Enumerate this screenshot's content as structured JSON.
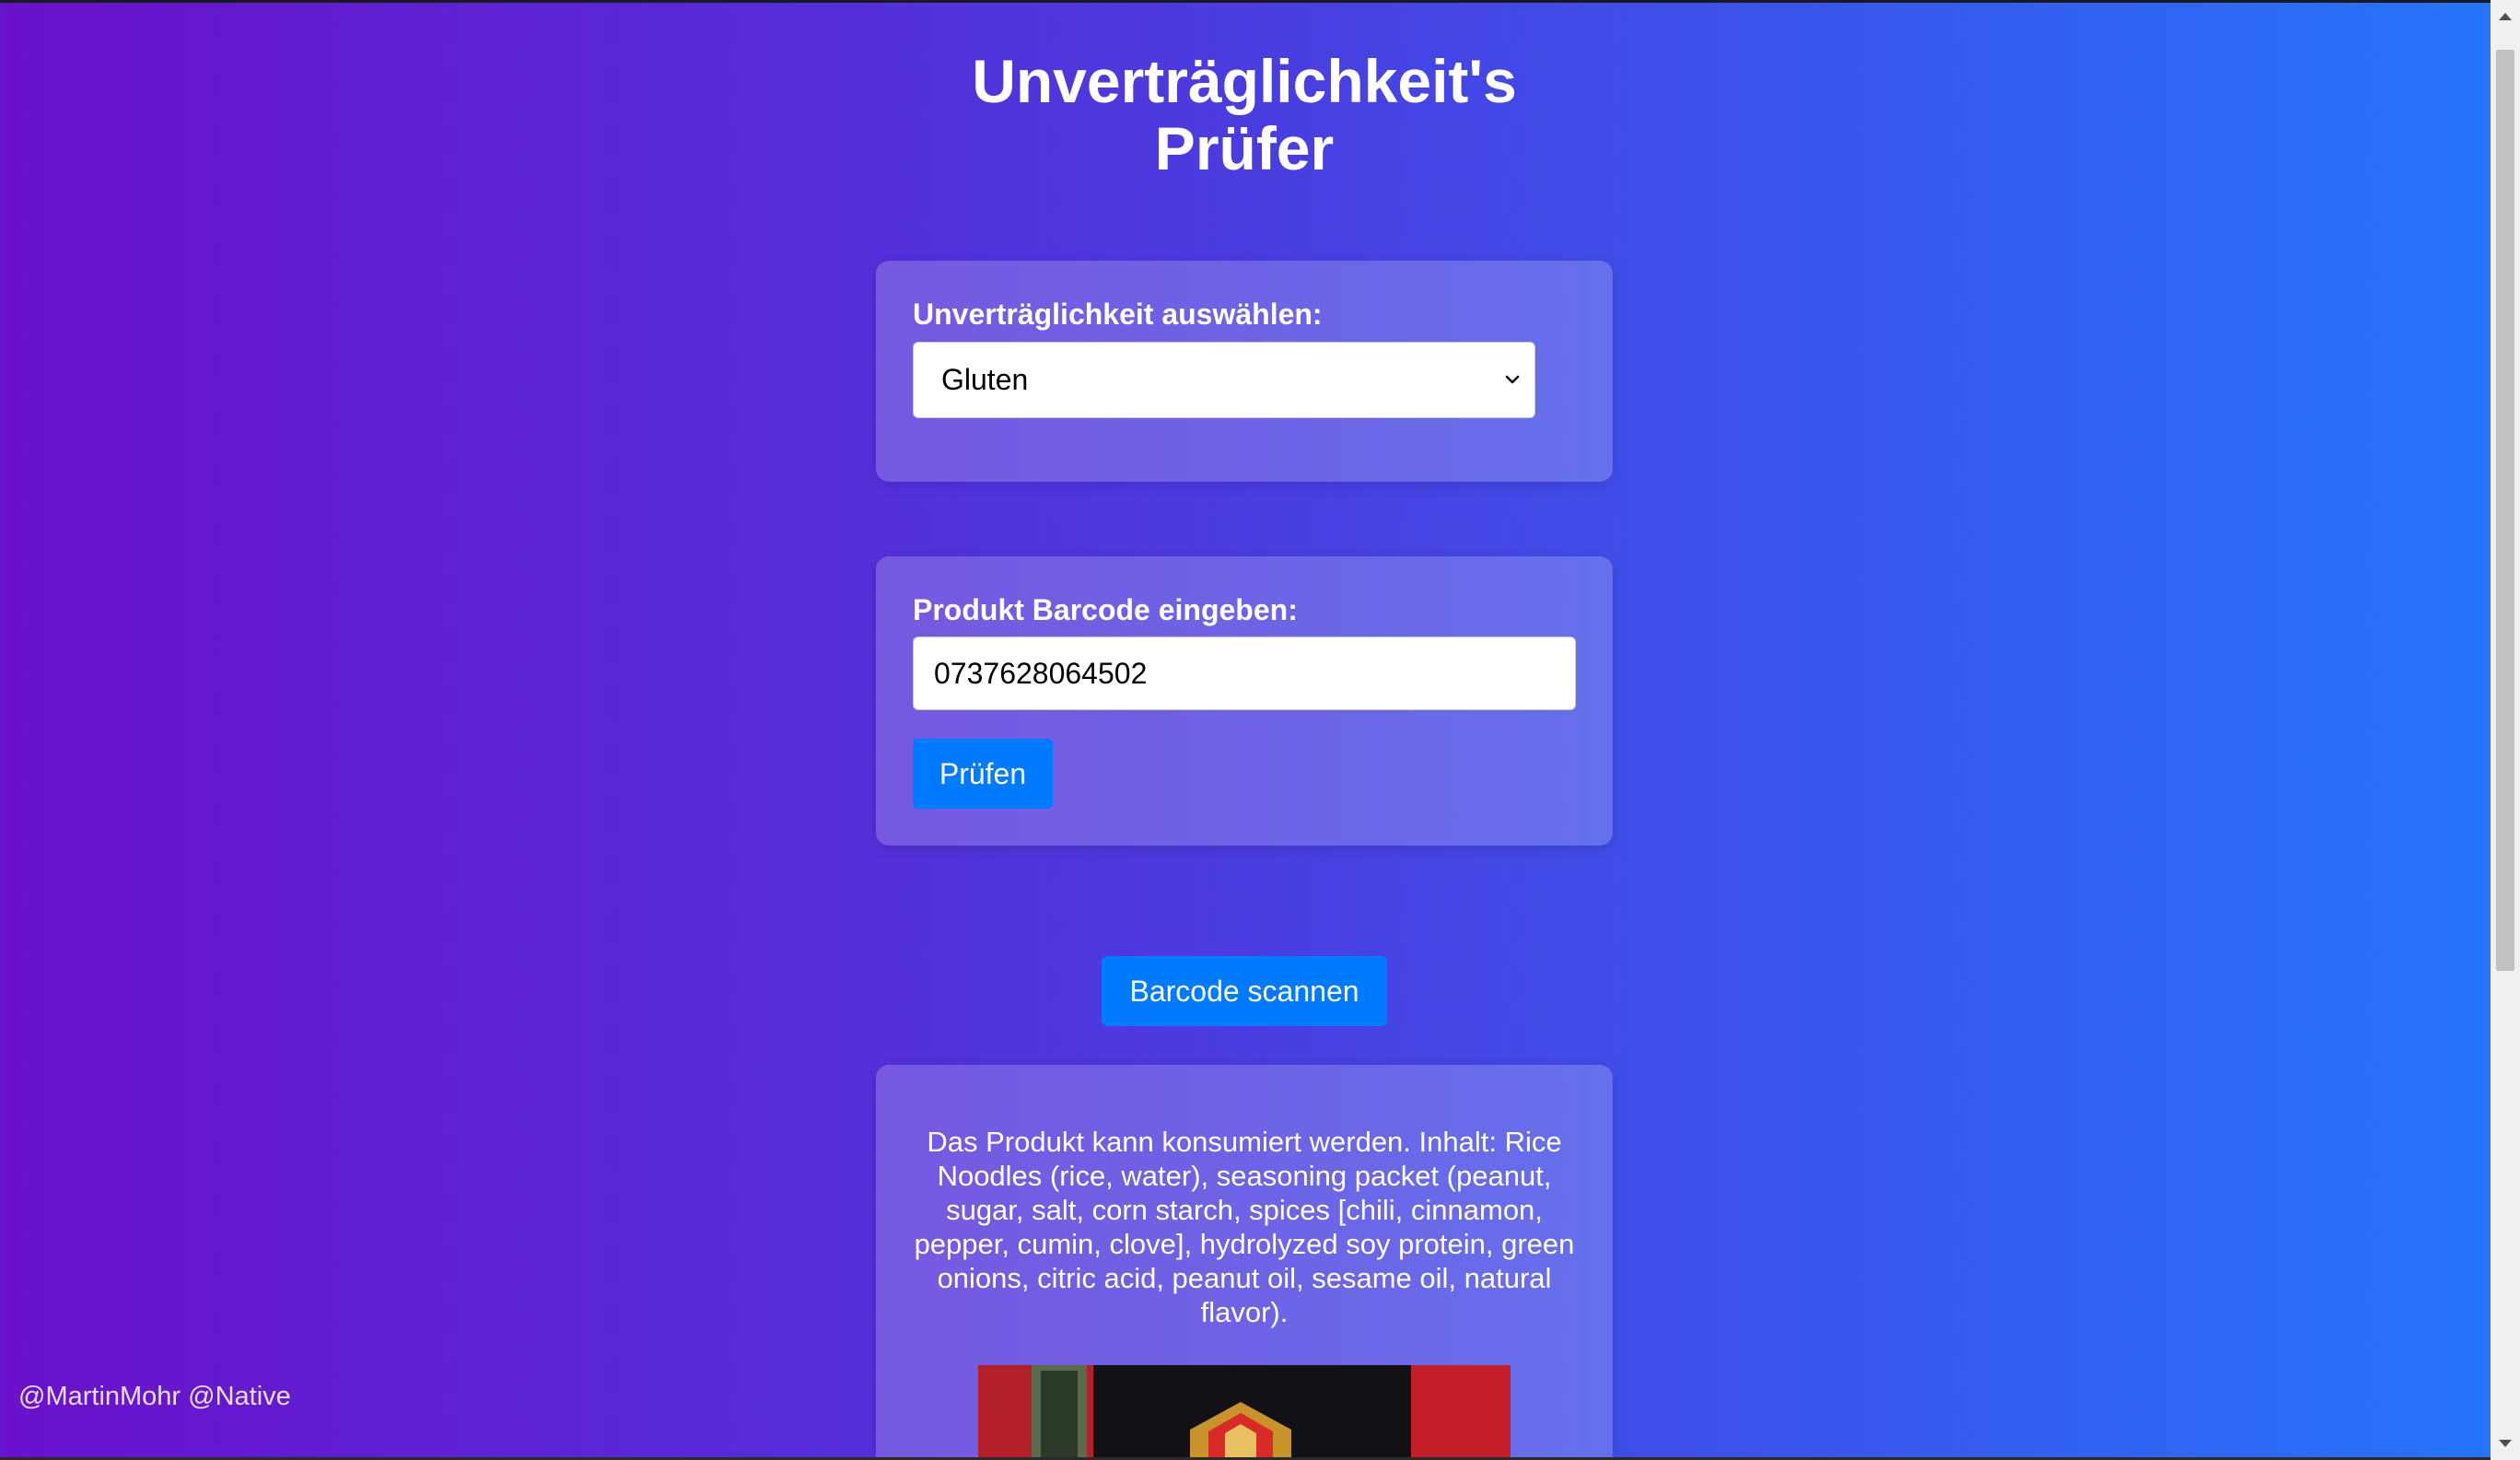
{
  "app": {
    "title": "Unverträglichkeit's\nPrüfer"
  },
  "allergy_card": {
    "label": "Unverträglichkeit auswählen:",
    "selected": "Gluten"
  },
  "barcode_card": {
    "label": "Produkt Barcode eingeben:",
    "value": "0737628064502",
    "check_button": "Prüfen"
  },
  "scan_button": "Barcode scannen",
  "result": {
    "text": "Das Produkt kann konsumiert werden. Inhalt: Rice Noodles (rice, water), seasoning packet (peanut, sugar, salt, corn starch, spices [chili, cinnamon, pepper, cumin, clove], hydrolyzed soy protein, green onions, citric acid, peanut oil, sesame oil, natural flavor)."
  },
  "footer": {
    "credit": "@MartinMohr @Native"
  },
  "colors": {
    "gradient_start": "#6a11cb",
    "gradient_end": "#2575fc",
    "button": "#007bff"
  }
}
